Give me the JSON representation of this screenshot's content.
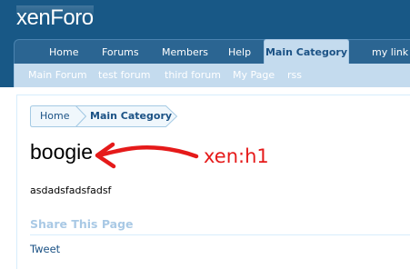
{
  "header": {
    "logo_text": "xenForo"
  },
  "nav": {
    "tabs": [
      {
        "label": "Home"
      },
      {
        "label": "Forums"
      },
      {
        "label": "Members"
      },
      {
        "label": "Help"
      },
      {
        "label": "Main Category",
        "selected": true
      },
      {
        "label": "my link"
      }
    ],
    "sub_items": [
      {
        "label": "Main Forum"
      },
      {
        "label": "test forum"
      },
      {
        "label": "third forum"
      },
      {
        "label": "My Page"
      },
      {
        "label": "rss"
      }
    ]
  },
  "breadcrumb": {
    "items": [
      {
        "label": "Home"
      },
      {
        "label": "Main Category"
      }
    ]
  },
  "page": {
    "title": "boogie",
    "annotation": "xen:h1",
    "message": "asdadsfadsfadsf"
  },
  "share": {
    "heading": "Share This Page",
    "tweet_label": "Tweet"
  },
  "colors": {
    "header_bg": "#185886",
    "nav_bg": "#2b6592",
    "selected_tab_bg": "#c4dbee",
    "link": "#1b5285",
    "share_heading": "#a9c9e5",
    "annotation": "#e51a1a"
  }
}
